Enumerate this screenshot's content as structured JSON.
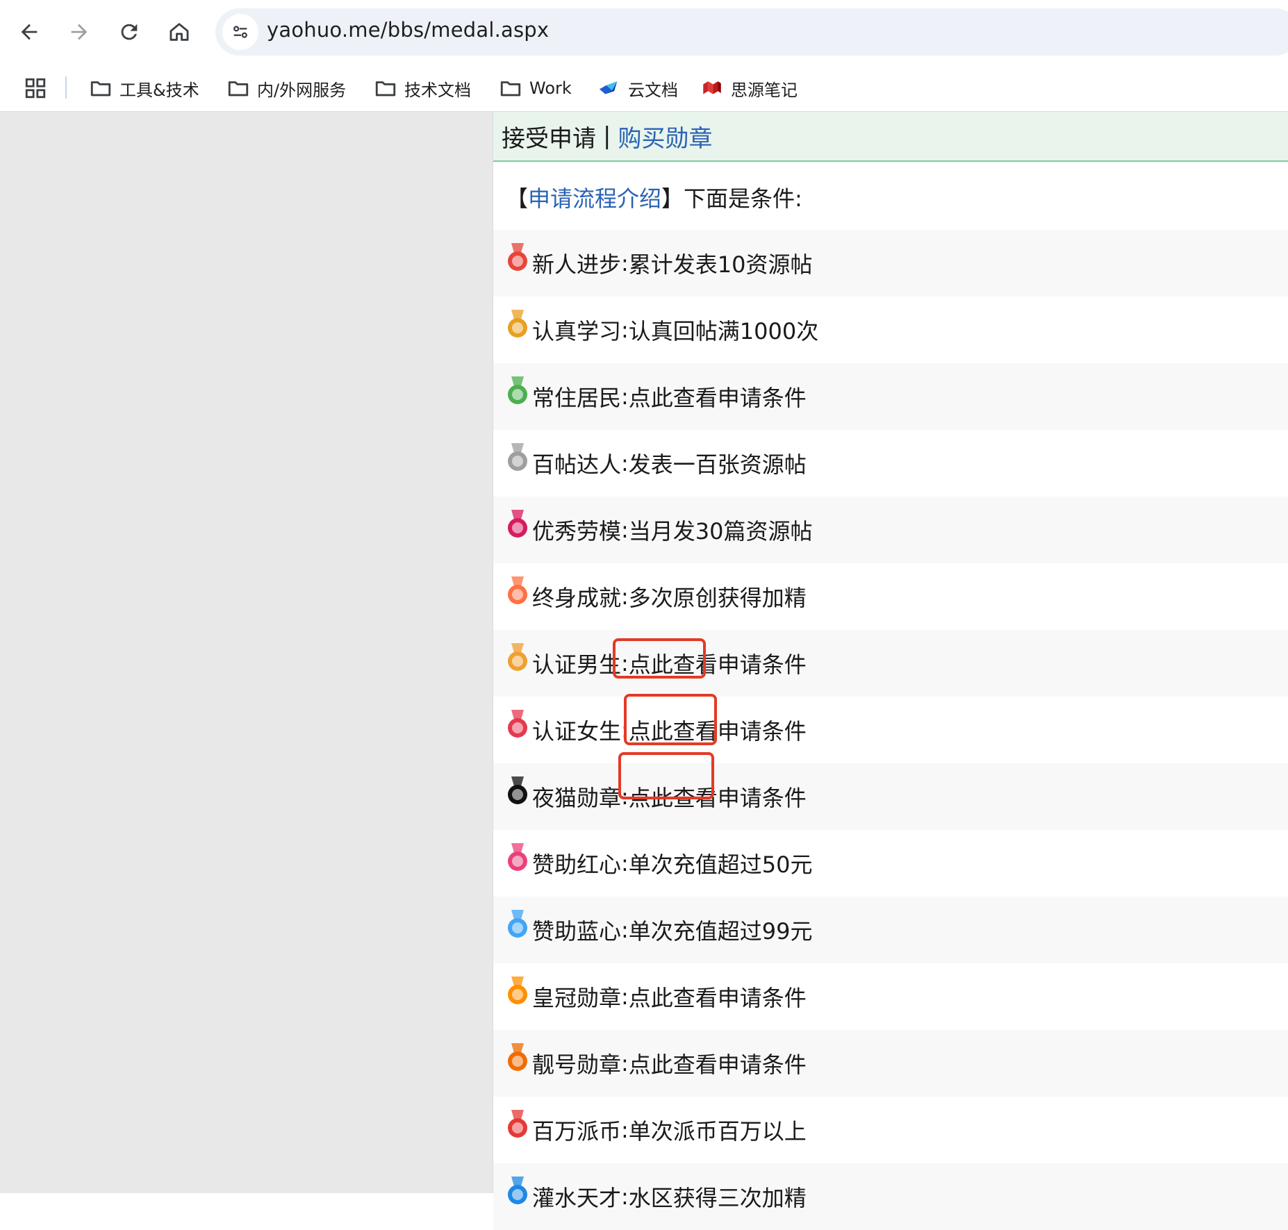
{
  "browser": {
    "url": "yaohuo.me/bbs/medal.aspx",
    "bookmarks": [
      {
        "label": "工具&技术",
        "icon": "folder-icon"
      },
      {
        "label": "内/外网服务",
        "icon": "folder-icon"
      },
      {
        "label": "技术文档",
        "icon": "folder-icon"
      },
      {
        "label": "Work",
        "icon": "folder-icon"
      },
      {
        "label": "云文档",
        "icon": "cloud-doc-icon"
      },
      {
        "label": "思源笔记",
        "icon": "siyuan-icon"
      }
    ]
  },
  "header": {
    "accept_label": "接受申请",
    "separator": "|",
    "buy_link": "购买勋章"
  },
  "intro": {
    "open_bracket": "【",
    "link": "申请流程介绍",
    "close_text": "】下面是条件:"
  },
  "medals": [
    {
      "name": "新人进步",
      "condition": "累计发表10资源帖",
      "icon": "new-badge-icon",
      "color": "#e8443a"
    },
    {
      "name": "认真学习",
      "condition": "认真回帖满1000次",
      "icon": "ring-medal-icon",
      "color": "#e8a020"
    },
    {
      "name": "常住居民",
      "condition": "点此查看申请条件",
      "icon": "house-icon",
      "color": "#4caf50"
    },
    {
      "name": "百帖达人",
      "condition": "发表一百张资源帖",
      "icon": "hundred-medal-icon",
      "color": "#9e9e9e"
    },
    {
      "name": "优秀劳模",
      "condition": "当月发30篇资源帖",
      "icon": "labor-badge-icon",
      "color": "#d81b60"
    },
    {
      "name": "终身成就",
      "condition": "多次原创获得加精",
      "icon": "excellent-badge-icon",
      "color": "#ff7043"
    },
    {
      "name": "认证男生",
      "condition": "点此查看申请条件",
      "icon": "male-medal-icon",
      "color": "#f0a030"
    },
    {
      "name": "认证女生",
      "condition": "点此查看申请条件",
      "icon": "female-bow-icon",
      "color": "#e53950"
    },
    {
      "name": "夜猫勋章",
      "condition": "点此查看申请条件",
      "icon": "night-cat-icon",
      "color": "#111111"
    },
    {
      "name": "赞助红心",
      "condition": "单次充值超过50元",
      "icon": "red-heart-icon",
      "color": "#ec407a"
    },
    {
      "name": "赞助蓝心",
      "condition": "单次充值超过99元",
      "icon": "blue-heart-icon",
      "color": "#42a5f5"
    },
    {
      "name": "皇冠勋章",
      "condition": "点此查看申请条件",
      "icon": "crown-medal-icon",
      "color": "#ff8f00"
    },
    {
      "name": "靓号勋章",
      "condition": "点此查看申请条件",
      "icon": "pretty-number-icon",
      "color": "#ef6c00"
    },
    {
      "name": "百万派币",
      "condition": "单次派币百万以上",
      "icon": "coin-bag-icon",
      "color": "#e53935"
    },
    {
      "name": "灌水天才",
      "condition": "水区获得三次加精",
      "icon": "water-medal-icon",
      "color": "#1e88e5"
    }
  ],
  "colors": {
    "link": "#2a62b5",
    "highlight": "#e33a25",
    "header_bg": "#e8f4ec",
    "header_border": "#7dc9a0",
    "left_panel": "#e8e8e8"
  }
}
